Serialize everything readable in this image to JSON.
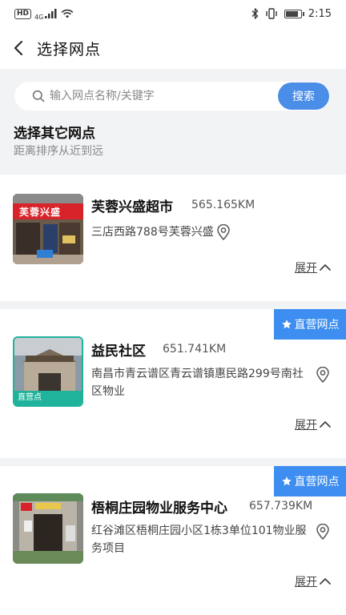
{
  "status_bar": {
    "carrier_badge": "HD",
    "network": "4G",
    "time": "2:15",
    "battery_level": 0.85,
    "icons": [
      "signal-icon",
      "wifi-icon",
      "bluetooth-icon",
      "vibrate-icon",
      "battery-icon"
    ]
  },
  "nav": {
    "title": "选择网点"
  },
  "search": {
    "placeholder": "输入网点名称/关键字",
    "button_label": "搜索"
  },
  "section": {
    "title": "选择其它网点",
    "subtitle": "距离排序从近到远"
  },
  "outlets": [
    {
      "name": "芙蓉兴盛超市",
      "distance": "565.165KM",
      "address": "三店西路788号芙蓉兴盛",
      "expand_label": "展开",
      "sign_text": "芙蓉兴盛"
    },
    {
      "name": "益民社区",
      "distance": "651.741KM",
      "address": "南昌市青云谱区青云谱镇惠民路299号南社区物业",
      "expand_label": "展开",
      "tag": "直营网点",
      "thumb_badge": "直营点"
    },
    {
      "name": "梧桐庄园物业服务中心",
      "distance": "657.739KM",
      "address": "红谷滩区梧桐庄园小区1栋3单位101物业服务项目",
      "expand_label": "展开",
      "tag": "直营网点"
    }
  ],
  "colors": {
    "accent": "#4b8ee8",
    "tag_blue": "#3d8ef0",
    "badge_teal": "#20b39b",
    "page_bg": "#f2f3f5"
  }
}
